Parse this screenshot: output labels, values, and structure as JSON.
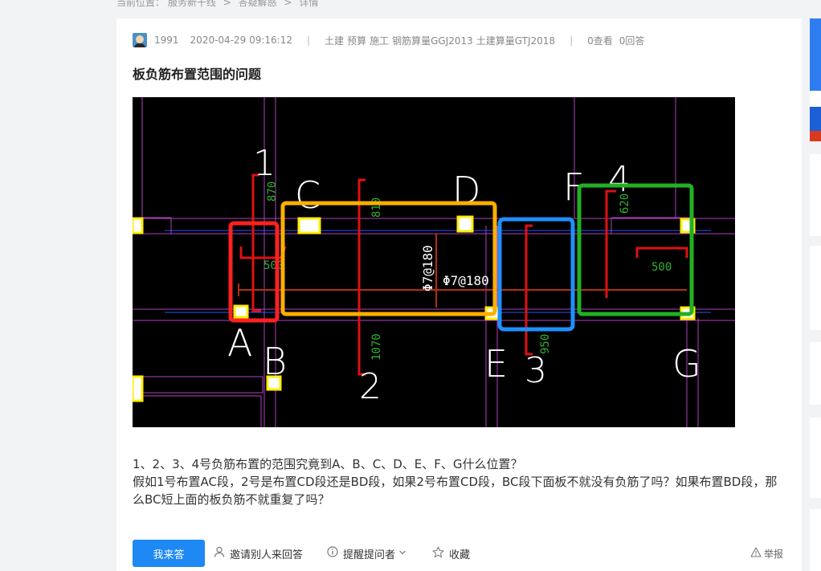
{
  "breadcrumb": {
    "prefix": "当前位置：",
    "items": [
      "服务新干线",
      "答疑解惑",
      "详情"
    ]
  },
  "question": {
    "user": "1991",
    "time": "2020-04-29 09:16:12",
    "tags": [
      "土建",
      "预算",
      "施工",
      "钢筋算量GGJ2013",
      "土建算量GTJ2018"
    ],
    "views": "0查看",
    "answers": "0回答",
    "title": "板负筋布置范围的问题",
    "body_line1": "1、2、3、4号负筋布置的范围究竟到A、B、C、D、E、F、G什么位置？",
    "body_line2": "假如1号布置AC段，2号是布置CD段还是BD段，如果2号布置CD段，BC段下面板不就没有负筋了吗？如果布置BD段，那么BC短上面的板负筋不就重复了吗？"
  },
  "drawing": {
    "rebar_numbers": [
      "1",
      "2",
      "3",
      "4"
    ],
    "axis_letters": [
      "A",
      "B",
      "C",
      "D",
      "E",
      "F",
      "G"
    ],
    "dims": [
      "870",
      "810",
      "500",
      "1070",
      "950",
      "620",
      "500"
    ],
    "rebar_spec": "Φ7@180",
    "box_colors": {
      "red": "#ff2020",
      "orange": "#ffb000",
      "blue": "#1e90ff",
      "green": "#22b022"
    }
  },
  "actions": {
    "answer": "我来答",
    "invite": "邀请别人来回答",
    "remind": "提醒提问者",
    "collect": "收藏",
    "report": "举报"
  },
  "colors": {
    "primary": "#1e88f5",
    "background": "#f2f3f5"
  }
}
